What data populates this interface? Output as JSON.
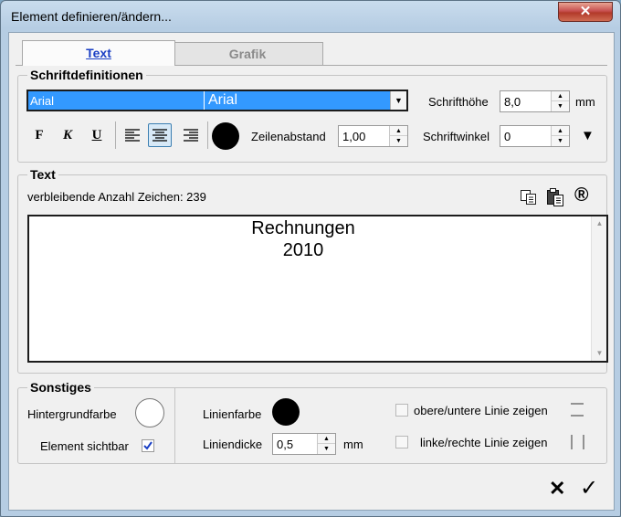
{
  "window": {
    "title": "Element definieren/ändern...",
    "close_glyph": "✕"
  },
  "tabs": [
    {
      "label": "Text",
      "active": true
    },
    {
      "label": "Grafik",
      "active": false
    }
  ],
  "font_group": {
    "legend": "Schriftdefinitionen",
    "font_name_left": "Arial",
    "font_name_right": "Arial",
    "dropdown_arrow": "▼",
    "schrifthoehe_label": "Schrifthöhe",
    "schrifthoehe_value": "8,0",
    "schrifthoehe_unit": "mm",
    "bold_label": "F",
    "italic_label": "K",
    "underline_label": "U",
    "align_selected": "center",
    "text_color": "#000000",
    "zeilenabstand_label": "Zeilenabstand",
    "zeilenabstand_value": "1,00",
    "schriftwinkel_label": "Schriftwinkel",
    "schriftwinkel_value": "0",
    "more_arrow": "▼"
  },
  "text_group": {
    "legend": "Text",
    "remaining_label": "verbleibende Anzahl Zeichen: 239",
    "icons": [
      "copy-icon",
      "paste-icon",
      "registered-icon"
    ],
    "registered_glyph": "®",
    "content_lines": [
      "Rechnungen",
      "2010"
    ]
  },
  "misc_group": {
    "legend": "Sonstiges",
    "hintergrundfarbe_label": "Hintergrundfarbe",
    "background_color": "#ffffff",
    "element_sichtbar_label": "Element sichtbar",
    "element_sichtbar_checked": true,
    "linienfarbe_label": "Linienfarbe",
    "line_color": "#000000",
    "liniendicke_label": "Liniendicke",
    "liniendicke_value": "0,5",
    "liniendicke_unit": "mm",
    "obere_untere_label": "obere/untere Linie zeigen",
    "obere_untere_checked": false,
    "linke_rechte_label": "linke/rechte Linie zeigen",
    "linke_rechte_checked": false
  },
  "footer": {
    "cancel_glyph": "✕",
    "ok_glyph": "✓"
  }
}
